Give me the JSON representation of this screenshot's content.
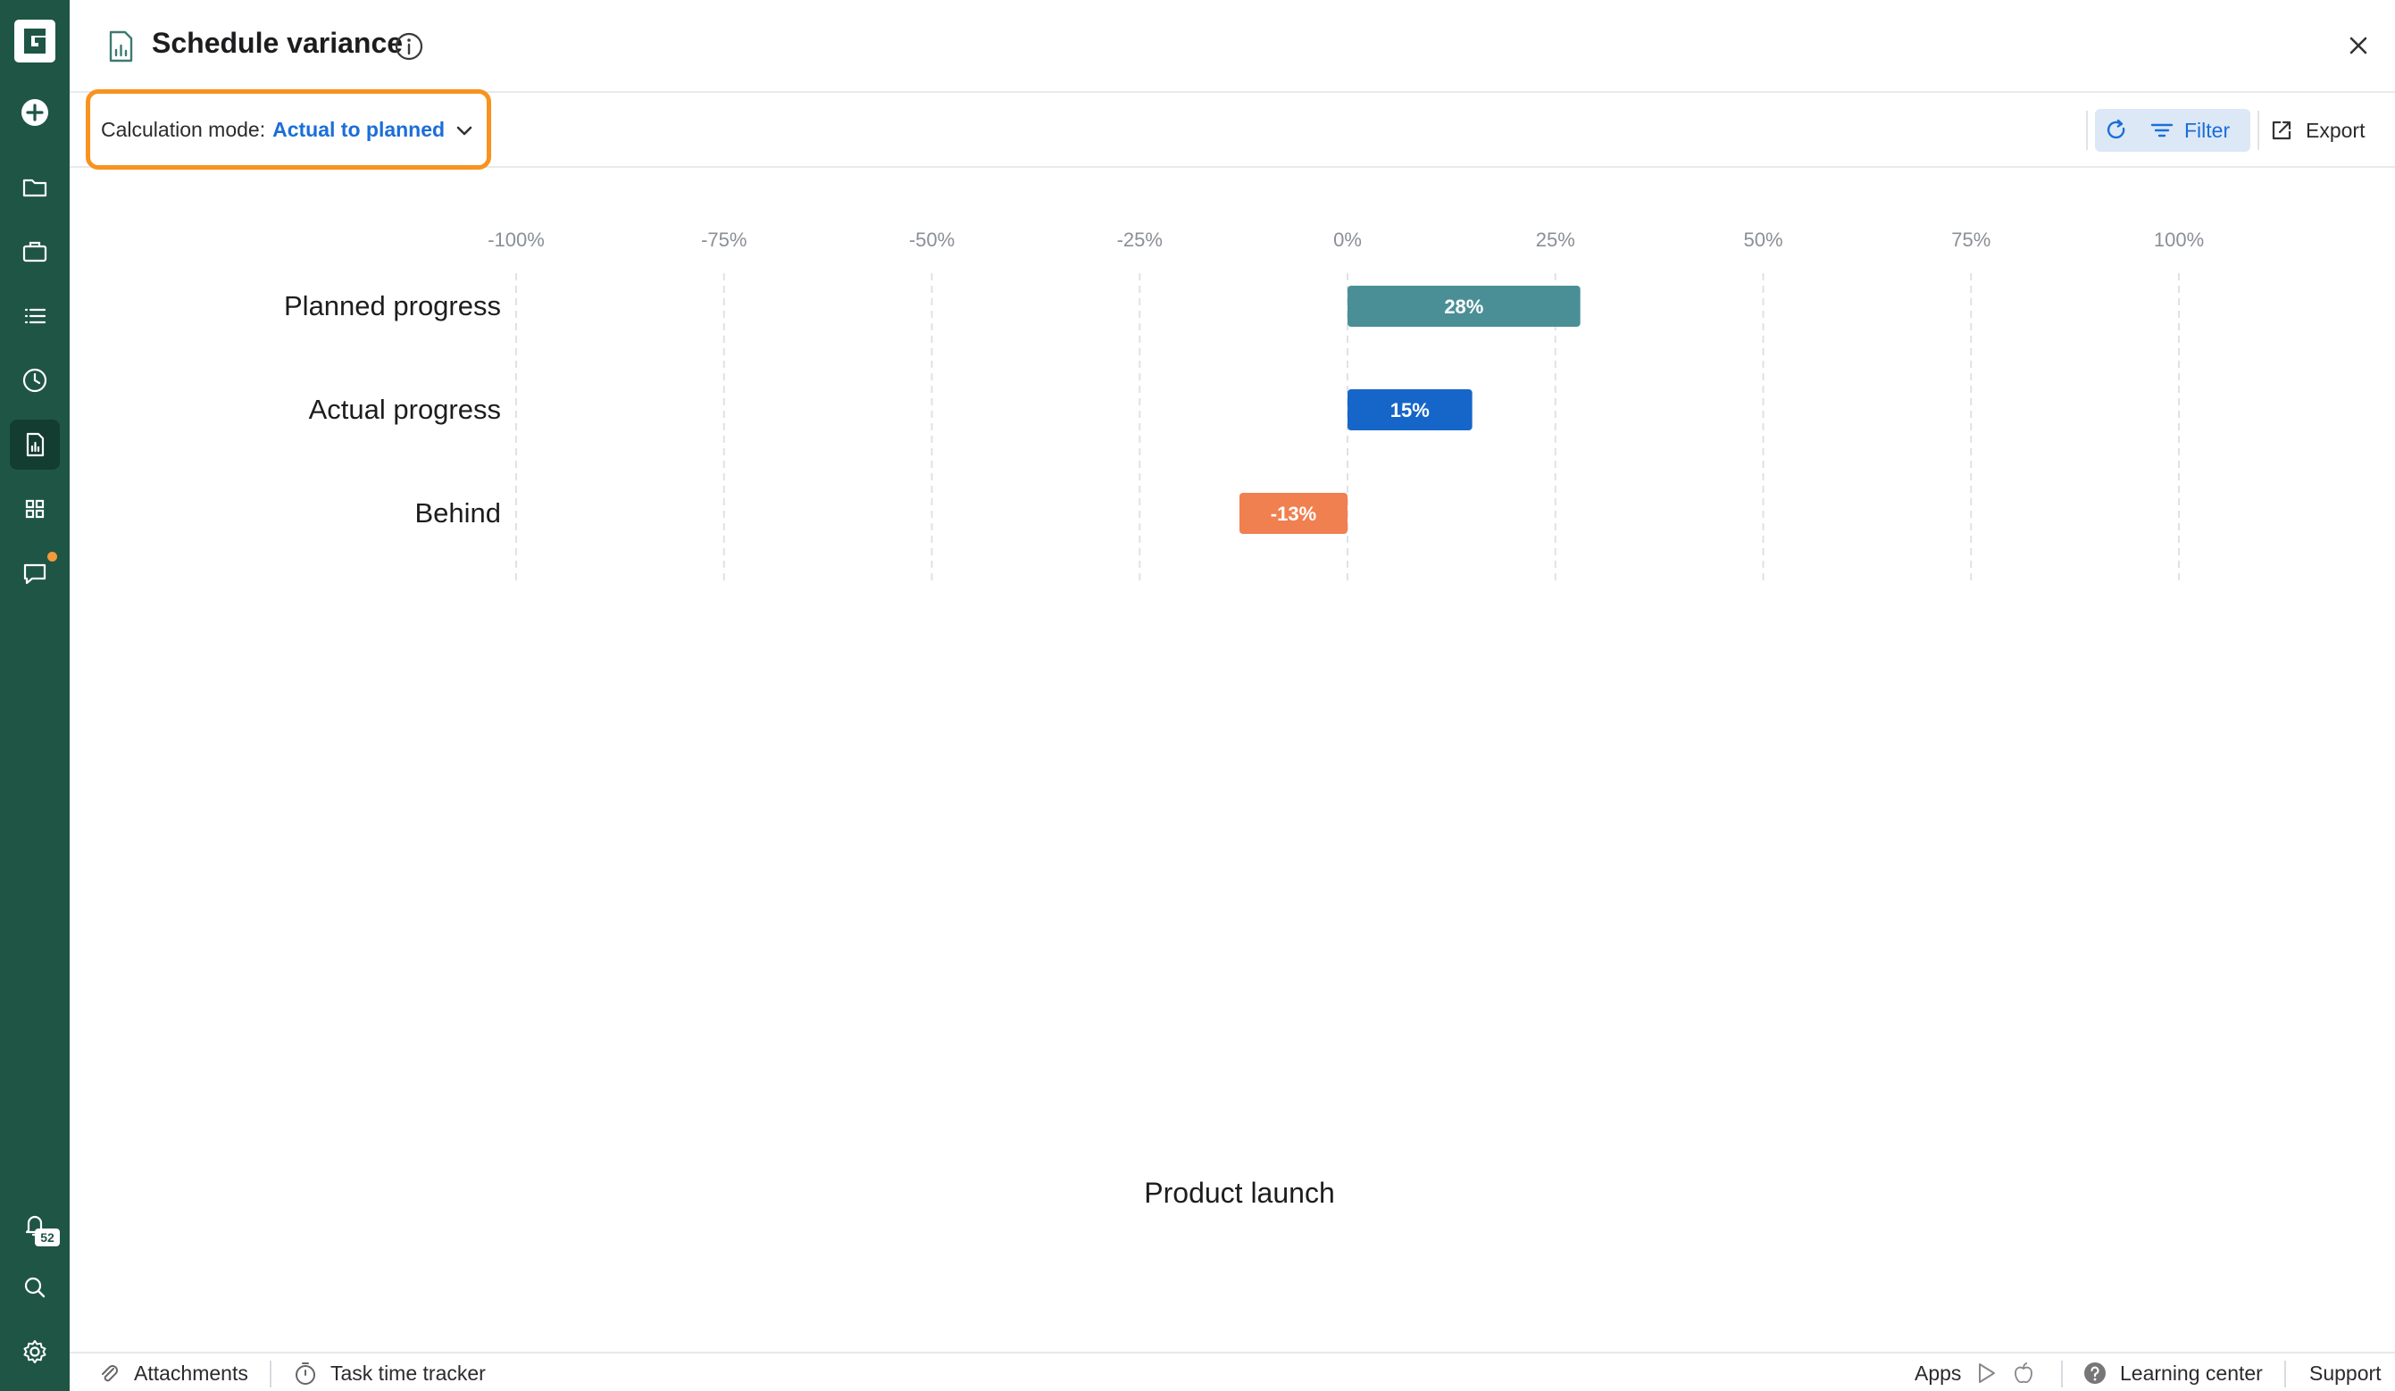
{
  "sidebar": {
    "logo": "G",
    "items": [
      {
        "name": "add-icon"
      },
      {
        "name": "folder-icon"
      },
      {
        "name": "briefcase-icon"
      },
      {
        "name": "list-icon"
      },
      {
        "name": "clock-icon"
      },
      {
        "name": "report-icon",
        "active": true
      },
      {
        "name": "grid-icon"
      },
      {
        "name": "chat-icon",
        "has_dot": true
      },
      {
        "name": "bell-icon",
        "badge": "52"
      },
      {
        "name": "search-icon"
      },
      {
        "name": "settings-icon"
      }
    ],
    "notification_badge": "52",
    "colors": {
      "background": "#1f5545",
      "active": "#133d31",
      "dot": "#f39a3a"
    }
  },
  "header": {
    "title": "Schedule variance",
    "icon": "report-icon",
    "info_icon": "info-icon",
    "close_icon": "close-icon"
  },
  "toolbar": {
    "calc_mode_label": "Calculation mode:",
    "calc_mode_value": "Actual to planned",
    "highlight_color": "#f7931e",
    "refresh_icon": "refresh-icon",
    "filter_label": "Filter",
    "export_label": "Export"
  },
  "chart_data": {
    "type": "bar",
    "orientation": "horizontal",
    "categories": [
      "Planned progress",
      "Actual progress",
      "Behind"
    ],
    "values": [
      28,
      15,
      -13
    ],
    "data_labels": [
      "28%",
      "15%",
      "-13%"
    ],
    "colors": [
      "#4a8f96",
      "#1666c9",
      "#f08050"
    ],
    "xlim": [
      -100,
      100
    ],
    "x_ticks": [
      -100,
      -75,
      -50,
      -25,
      0,
      25,
      50,
      75,
      100
    ],
    "x_tick_labels": [
      "-100%",
      "-75%",
      "-50%",
      "-25%",
      "0%",
      "25%",
      "50%",
      "75%",
      "100%"
    ],
    "grid": true,
    "axis_position": "top",
    "xlabel": "Product launch"
  },
  "footer": {
    "attachments_label": "Attachments",
    "time_tracker_label": "Task time tracker",
    "apps_label": "Apps",
    "learning_center_label": "Learning center",
    "support_label": "Support"
  }
}
